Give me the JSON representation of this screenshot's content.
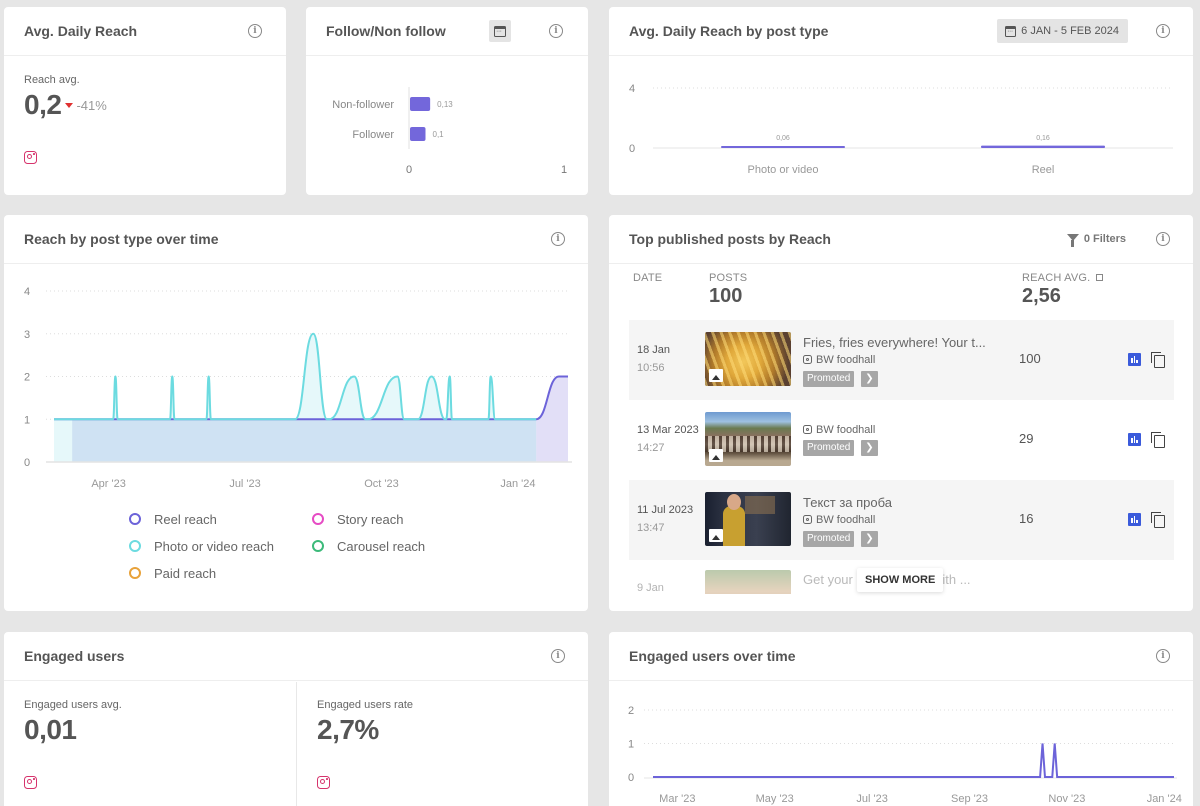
{
  "cards": {
    "avg_daily_reach": {
      "title": "Avg. Daily Reach",
      "stat_label": "Reach avg.",
      "stat_value": "0,2",
      "delta": "-41%",
      "delta_direction": "down",
      "delta_color": "#e03131",
      "platform_icon": "instagram-icon"
    },
    "follow_non_follow": {
      "title": "Follow/Non follow",
      "calendar_icon": "calendar-icon"
    },
    "avg_reach_by_type": {
      "title": "Avg. Daily Reach by post type",
      "date_range": "6 JAN - 5 FEB 2024"
    },
    "reach_over_time": {
      "title": "Reach by post type over time",
      "legend": [
        {
          "label": "Reel reach",
          "color": "#6c63d9"
        },
        {
          "label": "Story reach",
          "color": "#e64bc4"
        },
        {
          "label": "Photo or video reach",
          "color": "#6cdbe0"
        },
        {
          "label": "Carousel reach",
          "color": "#3cba7a"
        },
        {
          "label": "Paid reach",
          "color": "#e8a23a"
        }
      ]
    },
    "top_posts": {
      "title": "Top published posts by Reach",
      "filters_label": "0 Filters",
      "col_date": "DATE",
      "col_posts": "POSTS",
      "posts_count": "100",
      "col_reach": "REACH AVG.",
      "reach_avg": "2,56",
      "show_more": "SHOW MORE",
      "rows": [
        {
          "date": "18 Jan",
          "time": "10:56",
          "text": "Fries, fries everywhere! Your t...",
          "account": "BW foodhall",
          "badge": "Promoted",
          "reach": "100",
          "thumb": "fries"
        },
        {
          "date": "13 Mar 2023",
          "time": "14:27",
          "text": "",
          "account": "BW foodhall",
          "badge": "Promoted",
          "reach": "29",
          "thumb": "monastery"
        },
        {
          "date": "11 Jul 2023",
          "time": "13:47",
          "text": "Текст за проба",
          "account": "BW foodhall",
          "badge": "Promoted",
          "reach": "16",
          "thumb": "person"
        },
        {
          "date": "9 Jan",
          "time": "",
          "text": "Get your",
          "text_after": "k with ...",
          "account": "",
          "badge": "",
          "reach": "",
          "thumb": "burger"
        }
      ]
    },
    "engaged_users": {
      "title": "Engaged users",
      "avg_label": "Engaged users avg.",
      "avg_value": "0,01",
      "rate_label": "Engaged users rate",
      "rate_value": "2,7%"
    },
    "engaged_over_time": {
      "title": "Engaged users over time"
    }
  },
  "chart_data": [
    {
      "id": "follow_non_follow",
      "type": "bar",
      "orientation": "horizontal",
      "categories": [
        "Non-follower",
        "Follower"
      ],
      "values": [
        0.13,
        0.1
      ],
      "value_labels": [
        "0,13",
        "0,1"
      ],
      "xlim": [
        0,
        1
      ],
      "x_ticks": [
        "0",
        "1"
      ],
      "color": "#7367db"
    },
    {
      "id": "avg_reach_by_type",
      "type": "bar",
      "categories": [
        "Photo or video",
        "Reel"
      ],
      "values": [
        0.06,
        0.16
      ],
      "value_labels": [
        "0,06",
        "0,16"
      ],
      "ylim": [
        0,
        4
      ],
      "y_ticks": [
        "0",
        "4"
      ],
      "color": "#7367db",
      "grid": true
    },
    {
      "id": "reach_over_time",
      "type": "area",
      "x_ticks": [
        "Apr '23",
        "Jul '23",
        "Oct '23",
        "Jan '24"
      ],
      "ylim": [
        0,
        4
      ],
      "y_ticks": [
        "0",
        "1",
        "2",
        "3",
        "4"
      ],
      "grid": true,
      "x_range_months": [
        1.8,
        13.1
      ],
      "x_tick_positions_months": [
        3,
        6,
        9,
        12
      ],
      "series": [
        {
          "name": "Photo or video reach",
          "color": "#6cdbe0",
          "baseline": 1,
          "points": [
            [
              1.8,
              1
            ],
            [
              2.2,
              1
            ],
            [
              3.1,
              1
            ],
            [
              3.15,
              2
            ],
            [
              3.2,
              1
            ],
            [
              4.35,
              1
            ],
            [
              4.4,
              2
            ],
            [
              4.45,
              1
            ],
            [
              5.15,
              1
            ],
            [
              5.2,
              2
            ],
            [
              5.25,
              1
            ],
            [
              7.1,
              1
            ],
            [
              7.5,
              3
            ],
            [
              7.8,
              1
            ],
            [
              7.85,
              1
            ],
            [
              8.4,
              2
            ],
            [
              8.65,
              1
            ],
            [
              8.7,
              1
            ],
            [
              9.35,
              2
            ],
            [
              9.5,
              1
            ],
            [
              9.8,
              1
            ],
            [
              10.1,
              2
            ],
            [
              10.4,
              1
            ],
            [
              10.42,
              1
            ],
            [
              10.5,
              2
            ],
            [
              10.55,
              1
            ],
            [
              11.35,
              1
            ],
            [
              11.4,
              2
            ],
            [
              11.5,
              1
            ],
            [
              12.4,
              1
            ]
          ]
        },
        {
          "name": "Reel reach",
          "color": "#6c63d9",
          "baseline": 1,
          "points": [
            [
              1.8,
              1
            ],
            [
              12.4,
              1
            ],
            [
              12.9,
              2
            ],
            [
              13.1,
              2
            ]
          ]
        }
      ]
    },
    {
      "id": "engaged_over_time",
      "type": "line",
      "x_ticks": [
        "Mar '23",
        "May '23",
        "Jul '23",
        "Sep '23",
        "Nov '23",
        "Jan '24"
      ],
      "ylim": [
        0,
        2
      ],
      "y_ticks": [
        "0",
        "1",
        "2"
      ],
      "grid": true,
      "x_range_months": [
        2.5,
        13.2
      ],
      "x_tick_positions_months": [
        3,
        5,
        7,
        9,
        11,
        13
      ],
      "series": [
        {
          "name": "Engaged users",
          "color": "#6c63d9",
          "points": [
            [
              2.5,
              0
            ],
            [
              10.45,
              0
            ],
            [
              10.5,
              1
            ],
            [
              10.55,
              0
            ],
            [
              10.7,
              0
            ],
            [
              10.75,
              1
            ],
            [
              10.8,
              0
            ],
            [
              13.2,
              0
            ]
          ]
        }
      ]
    }
  ]
}
